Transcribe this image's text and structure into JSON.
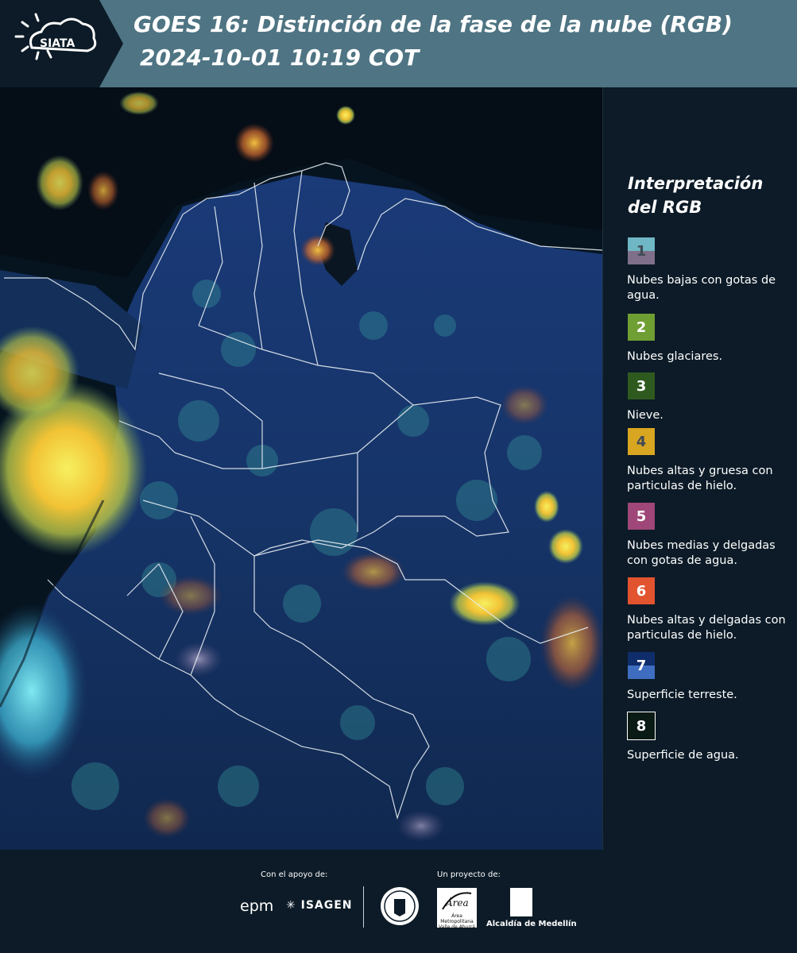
{
  "header": {
    "logo_text": "SIATA",
    "title_line1": "GOES 16: Distinción de la fase de la nube (RGB)",
    "title_line2": "2024-10-01 10:19 COT"
  },
  "map": {
    "region": "Colombia",
    "background_color": "#061420"
  },
  "legend": {
    "title": "Interpretación del RGB",
    "items": [
      {
        "number": "1",
        "label": "Nubes bajas con gotas de agua.",
        "colors": [
          "#6fb7c4",
          "#7f6f8a"
        ]
      },
      {
        "number": "2",
        "label": "Nubes glaciares.",
        "colors": [
          "#6f9e33"
        ]
      },
      {
        "number": "3",
        "label": "Nieve.",
        "colors": [
          "#2f5a1f"
        ]
      },
      {
        "number": "4",
        "label": "Nubes altas y gruesa con particulas de hielo.",
        "colors": [
          "#d9a621"
        ]
      },
      {
        "number": "5",
        "label": "Nubes medias y delgadas con gotas de agua.",
        "colors": [
          "#9e4778"
        ]
      },
      {
        "number": "6",
        "label": "Nubes altas y delgadas con particulas de hielo.",
        "colors": [
          "#e2532f"
        ]
      },
      {
        "number": "7",
        "label": "Superficie terreste.",
        "colors": [
          "#0f2d6b",
          "#3f6ec0"
        ]
      },
      {
        "number": "8",
        "label": "Superficie de agua.",
        "colors": [
          "#0a1a14"
        ]
      }
    ]
  },
  "footer": {
    "support_label": "Con el apoyo de:",
    "project_label": "Un proyecto de:",
    "sponsor_1": "epm",
    "sponsor_2": "ISAGEN",
    "area_logo_text": "Área Metropolitana Valle de Aburrá",
    "alcaldia": "Alcaldía de Medellín"
  }
}
